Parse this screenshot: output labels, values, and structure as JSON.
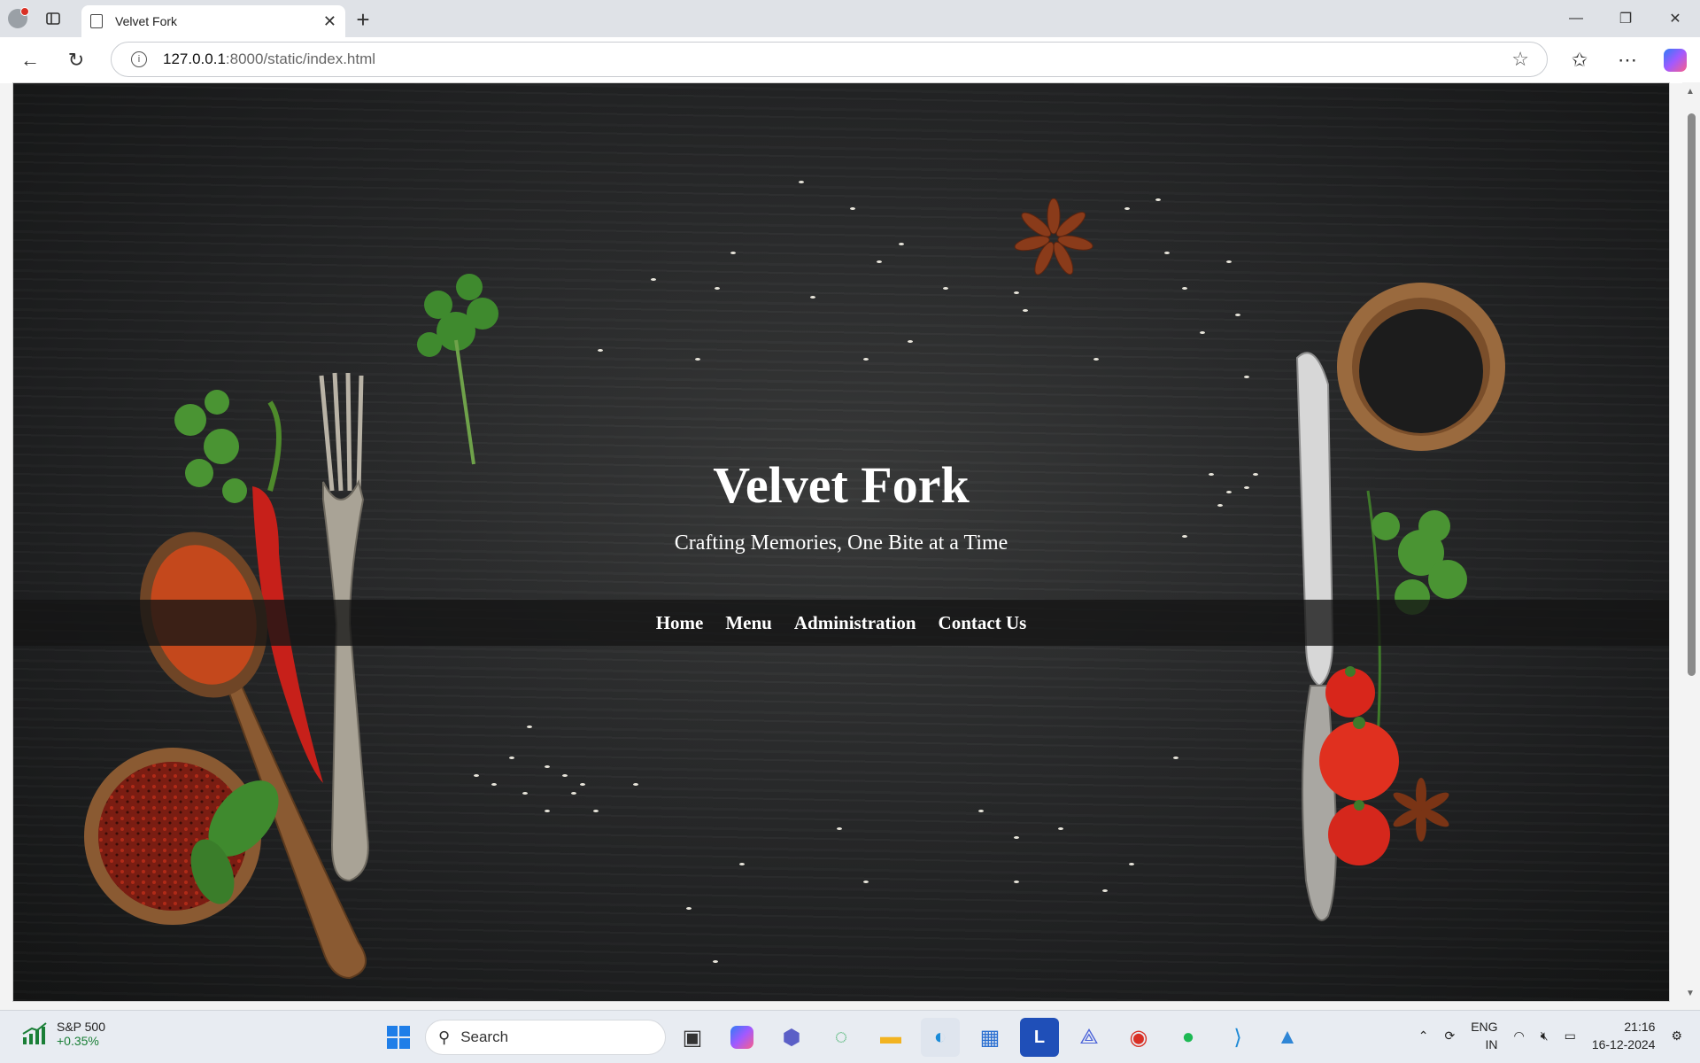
{
  "browser": {
    "tab_title": "Velvet Fork",
    "url_host": "127.0.0.1",
    "url_path": ":8000/static/index.html"
  },
  "page": {
    "title": "Velvet Fork",
    "tagline": "Crafting Memories, One Bite at a Time",
    "nav": [
      {
        "label": "Home"
      },
      {
        "label": "Menu"
      },
      {
        "label": "Administration"
      },
      {
        "label": "Contact Us"
      }
    ]
  },
  "taskbar": {
    "stock_name": "S&P 500",
    "stock_change": "+0.35%",
    "search_placeholder": "Search",
    "lang_line1": "ENG",
    "lang_line2": "IN",
    "time": "21:16",
    "date": "16-12-2024"
  },
  "colors": {
    "hero_bg": "#232425",
    "nav_band": "#141414",
    "text": "#ffffff"
  }
}
